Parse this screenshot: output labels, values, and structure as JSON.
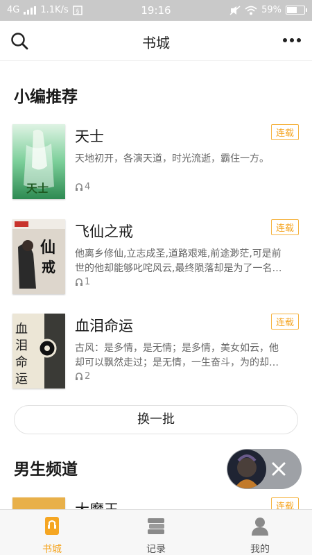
{
  "status_bar": {
    "network": "4G",
    "speed": "1.1K/s",
    "time": "19:16",
    "battery": "59%",
    "battery_level": 0.59
  },
  "nav": {
    "title": "书城"
  },
  "sections": {
    "editor_pick": "小编推荐",
    "male_channel": "男生频道"
  },
  "books": [
    {
      "title": "天士",
      "desc": "天地初开，各演天道，时光流逝，霸住一方。",
      "badge": "连载",
      "listens": "4"
    },
    {
      "title": "飞仙之戒",
      "desc": "他离乡修仙,立志成圣,道路艰难,前途渺茫,可是前世的他却能够叱咤风云,最终陨落却是为了一名女子。",
      "badge": "连载",
      "listens": "1"
    },
    {
      "title": "血泪命运",
      "desc": "古风：是多情，是无情；是多情，美女如云，他却可以飘然走过；是无情，一生奋斗，为的却都是…",
      "badge": "连载",
      "listens": "2"
    },
    {
      "title": "大魔王",
      "badge": "连载"
    }
  ],
  "refresh_button": "换一批",
  "tabs": [
    {
      "label": "书城",
      "active": true
    },
    {
      "label": "记录",
      "active": false
    },
    {
      "label": "我的",
      "active": false
    }
  ],
  "colors": {
    "accent": "#f5a623",
    "status_bar_bg": "#c9c9c9"
  }
}
